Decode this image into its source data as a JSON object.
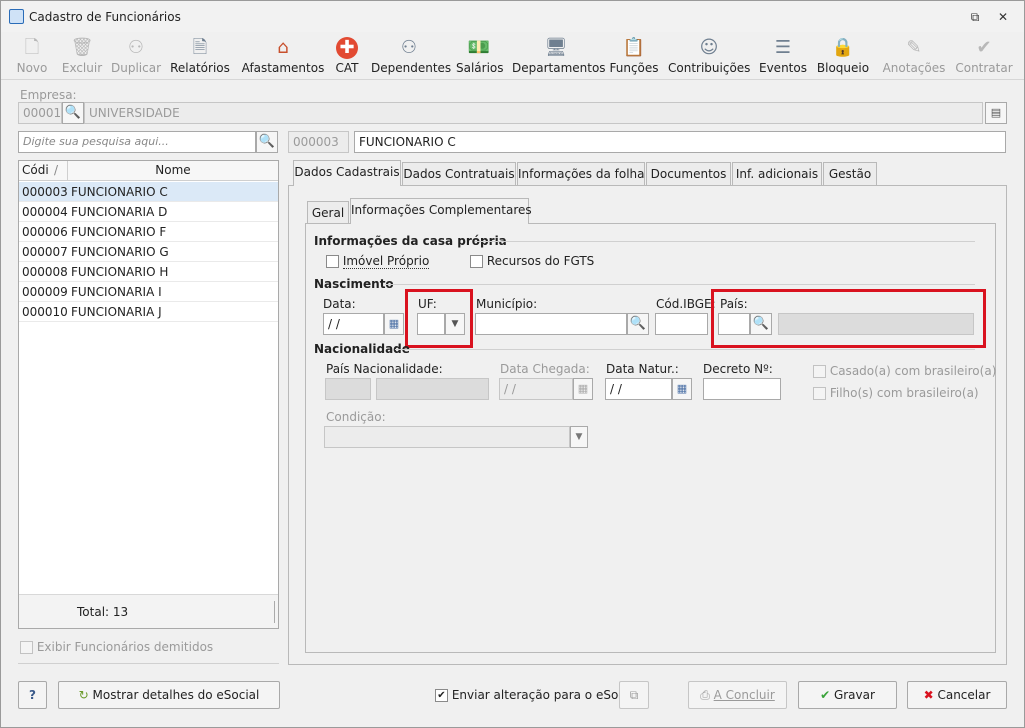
{
  "window": {
    "title": "Cadastro de Funcionários"
  },
  "toolbar": [
    {
      "label": "Novo",
      "icon": "new-doc-icon",
      "enabled": false
    },
    {
      "label": "Excluir",
      "icon": "trash-icon",
      "enabled": false
    },
    {
      "label": "Duplicar",
      "icon": "duplicate-users-icon",
      "enabled": false
    },
    {
      "label": "Relatórios",
      "icon": "report-icon",
      "enabled": true
    },
    {
      "label": "Afastamentos",
      "icon": "leave-house-icon",
      "enabled": true
    },
    {
      "label": "CAT",
      "icon": "red-cross-icon",
      "enabled": true
    },
    {
      "label": "Dependentes",
      "icon": "dependents-icon",
      "enabled": true
    },
    {
      "label": "Salários",
      "icon": "salary-icon",
      "enabled": true
    },
    {
      "label": "Departamentos",
      "icon": "department-icon",
      "enabled": true
    },
    {
      "label": "Funções",
      "icon": "badge-icon",
      "enabled": true
    },
    {
      "label": "Contribuições",
      "icon": "contribution-icon",
      "enabled": true
    },
    {
      "label": "Eventos",
      "icon": "events-icon",
      "enabled": true
    },
    {
      "label": "Bloqueio",
      "icon": "lock-icon",
      "enabled": true
    },
    {
      "label": "Anotações",
      "icon": "notes-icon",
      "enabled": false
    },
    {
      "label": "Contratar",
      "icon": "hire-icon",
      "enabled": false
    }
  ],
  "empresa": {
    "label": "Empresa:",
    "code": "00001",
    "name": "UNIVERSIDADE"
  },
  "search": {
    "placeholder": "Digite sua pesquisa aqui..."
  },
  "employee": {
    "code": "000003",
    "name": "FUNCIONARIO C"
  },
  "grid": {
    "headers": [
      "Códi",
      "Nome"
    ],
    "rows": [
      {
        "code": "000003",
        "name": "FUNCIONARIO C",
        "selected": true
      },
      {
        "code": "000004",
        "name": "FUNCIONARIA D"
      },
      {
        "code": "000006",
        "name": "FUNCIONARIO F"
      },
      {
        "code": "000007",
        "name": "FUNCIONARIO G"
      },
      {
        "code": "000008",
        "name": "FUNCIONARIO H"
      },
      {
        "code": "000009",
        "name": "FUNCIONARIA I"
      },
      {
        "code": "000010",
        "name": "FUNCIONARIA J"
      }
    ],
    "total": "Total: 13"
  },
  "exibir_demitidos": "Exibir Funcionários demitidos",
  "tabs": [
    "Dados Cadastrais",
    "Dados Contratuais",
    "Informações da folha",
    "Documentos",
    "Inf. adicionais",
    "Gestão"
  ],
  "subtabs": [
    "Geral",
    "Informações Complementares"
  ],
  "casa_propria": {
    "title": "Informações da casa própria",
    "imovel": "Imóvel Próprio",
    "fgts": "Recursos do FGTS"
  },
  "nascimento": {
    "title": "Nascimento",
    "data_label": "Data:",
    "data_value": " / /",
    "uf_label": "UF:",
    "municipio_label": "Município:",
    "ibge_label": "Cód.IBGE:",
    "pais_label": "País:"
  },
  "nacionalidade": {
    "title": "Nacionalidade",
    "pais_label": "País Nacionalidade:",
    "chegada_label": "Data Chegada:",
    "chegada_value": " / /",
    "natur_label": "Data Natur.:",
    "natur_value": " / /",
    "decreto_label": "Decreto Nº:",
    "casado": "Casado(a) com brasileiro(a)",
    "filhos": "Filho(s) com brasileiro(a)",
    "condicao_label": "Condição:"
  },
  "footer": {
    "help": "?",
    "esocial_details": "Mostrar detalhes do eSocial",
    "enviar": "Enviar alteração para o eSocial",
    "concluir": "A Concluir",
    "gravar": "Gravar",
    "cancelar": "Cancelar"
  },
  "colors": {
    "highlight": "#d9121f",
    "selection": "#dbe9f7"
  }
}
